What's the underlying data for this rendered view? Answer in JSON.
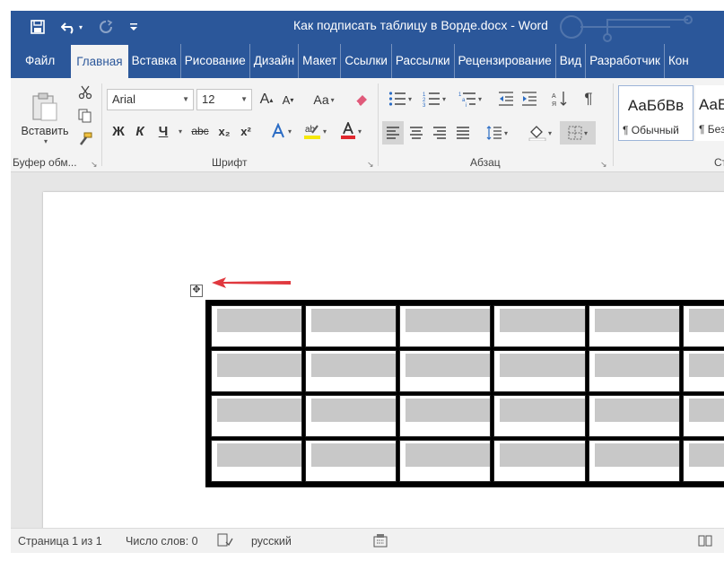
{
  "window": {
    "title": "Как подписать таблицу в Ворде.docx  -  Word"
  },
  "colors": {
    "accent": "#2b579a",
    "arrow": "#e0383e",
    "cell_shade": "#c8c8c8"
  },
  "tabs": [
    {
      "label": "Файл"
    },
    {
      "label": "Главная"
    },
    {
      "label": "Вставка"
    },
    {
      "label": "Рисование"
    },
    {
      "label": "Дизайн"
    },
    {
      "label": "Макет"
    },
    {
      "label": "Ссылки"
    },
    {
      "label": "Рассылки"
    },
    {
      "label": "Рецензирование"
    },
    {
      "label": "Вид"
    },
    {
      "label": "Разработчик"
    },
    {
      "label": "Кон"
    }
  ],
  "ribbon": {
    "clipboard": {
      "label": "Буфер обм...",
      "paste_label": "Вставить"
    },
    "font": {
      "label": "Шрифт",
      "font_name": "Arial",
      "font_size": "12",
      "change_case": "Аа",
      "bold": "Ж",
      "italic": "К",
      "underline": "Ч",
      "strike": "abc",
      "subscript": "x₂",
      "superscript": "x²",
      "grow": "A",
      "shrink": "A"
    },
    "paragraph": {
      "label": "Абзац",
      "pilcrow": "¶"
    },
    "styles": {
      "label": "Ст",
      "items": [
        {
          "sample": "АаБбВв",
          "name": "¶ Обычный"
        },
        {
          "sample": "АаБ",
          "name": "¶ Без"
        }
      ]
    }
  },
  "document": {
    "table": {
      "rows": 4,
      "cols": 6
    }
  },
  "status": {
    "page": "Страница 1 из 1",
    "words": "Число слов: 0",
    "language": "русский"
  }
}
